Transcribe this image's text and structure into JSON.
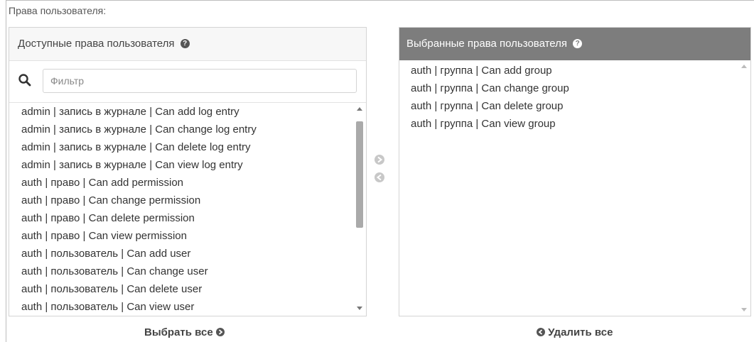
{
  "field_label": "Права пользователя:",
  "available": {
    "title": "Доступные права пользователя",
    "filter_placeholder": "Фильтр",
    "items": [
      "admin | запись в журнале | Can add log entry",
      "admin | запись в журнале | Can change log entry",
      "admin | запись в журнале | Can delete log entry",
      "admin | запись в журнале | Can view log entry",
      "auth | право | Can add permission",
      "auth | право | Can change permission",
      "auth | право | Can delete permission",
      "auth | право | Can view permission",
      "auth | пользователь | Can add user",
      "auth | пользователь | Can change user",
      "auth | пользователь | Can delete user",
      "auth | пользователь | Can view user"
    ],
    "choose_all": "Выбрать все"
  },
  "chosen": {
    "title": "Выбранные права пользователя",
    "items": [
      "auth | группа | Can add group",
      "auth | группа | Can change group",
      "auth | группа | Can delete group",
      "auth | группа | Can view group"
    ],
    "remove_all": "Удалить все"
  },
  "icons": {
    "help": "question-circle-icon",
    "search": "search-icon",
    "add": "arrow-right-circle-icon",
    "remove": "arrow-left-circle-icon"
  },
  "colors": {
    "chosen_header": "#7d7d7d",
    "available_header": "#f7f7f7"
  }
}
